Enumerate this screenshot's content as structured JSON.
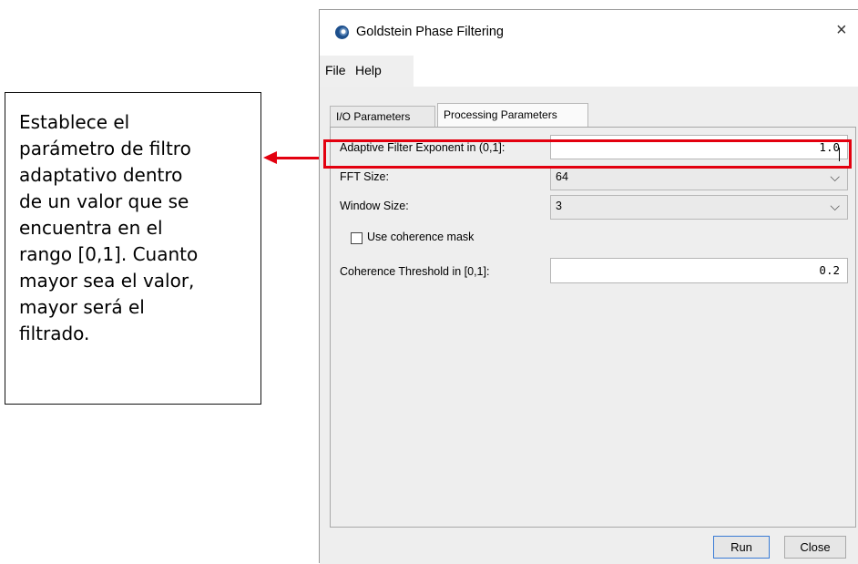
{
  "callout": {
    "lines": [
      "Establece el",
      "parámetro de filtro",
      "adaptativo dentro",
      "de un valor que se",
      "encuentra en el",
      "rango [0,1]. Cuanto",
      "mayor sea el valor,",
      "mayor será el",
      "filtrado."
    ]
  },
  "window": {
    "title": "Goldstein Phase Filtering",
    "close_glyph": "×"
  },
  "menu": {
    "file": "File",
    "help": "Help"
  },
  "tabs": {
    "io": "I/O Parameters",
    "processing": "Processing Parameters"
  },
  "form": {
    "adaptive_label": "Adaptive Filter Exponent in (0,1]:",
    "adaptive_value": "1.0",
    "fft_label": "FFT Size:",
    "fft_value": "64",
    "window_label": "Window Size:",
    "window_value": "3",
    "coherence_mask_label": "Use coherence mask",
    "coherence_mask_checked": false,
    "threshold_label": "Coherence Threshold in [0,1]:",
    "threshold_value": "0.2"
  },
  "buttons": {
    "run": "Run",
    "close": "Close"
  },
  "icons": {
    "app": "snap-app-icon",
    "close": "close-icon",
    "dropdown": "chevron-down-icon",
    "arrow": "arrow-left-icon"
  },
  "colors": {
    "highlight": "#e3000f",
    "arrow": "#e3000f"
  }
}
